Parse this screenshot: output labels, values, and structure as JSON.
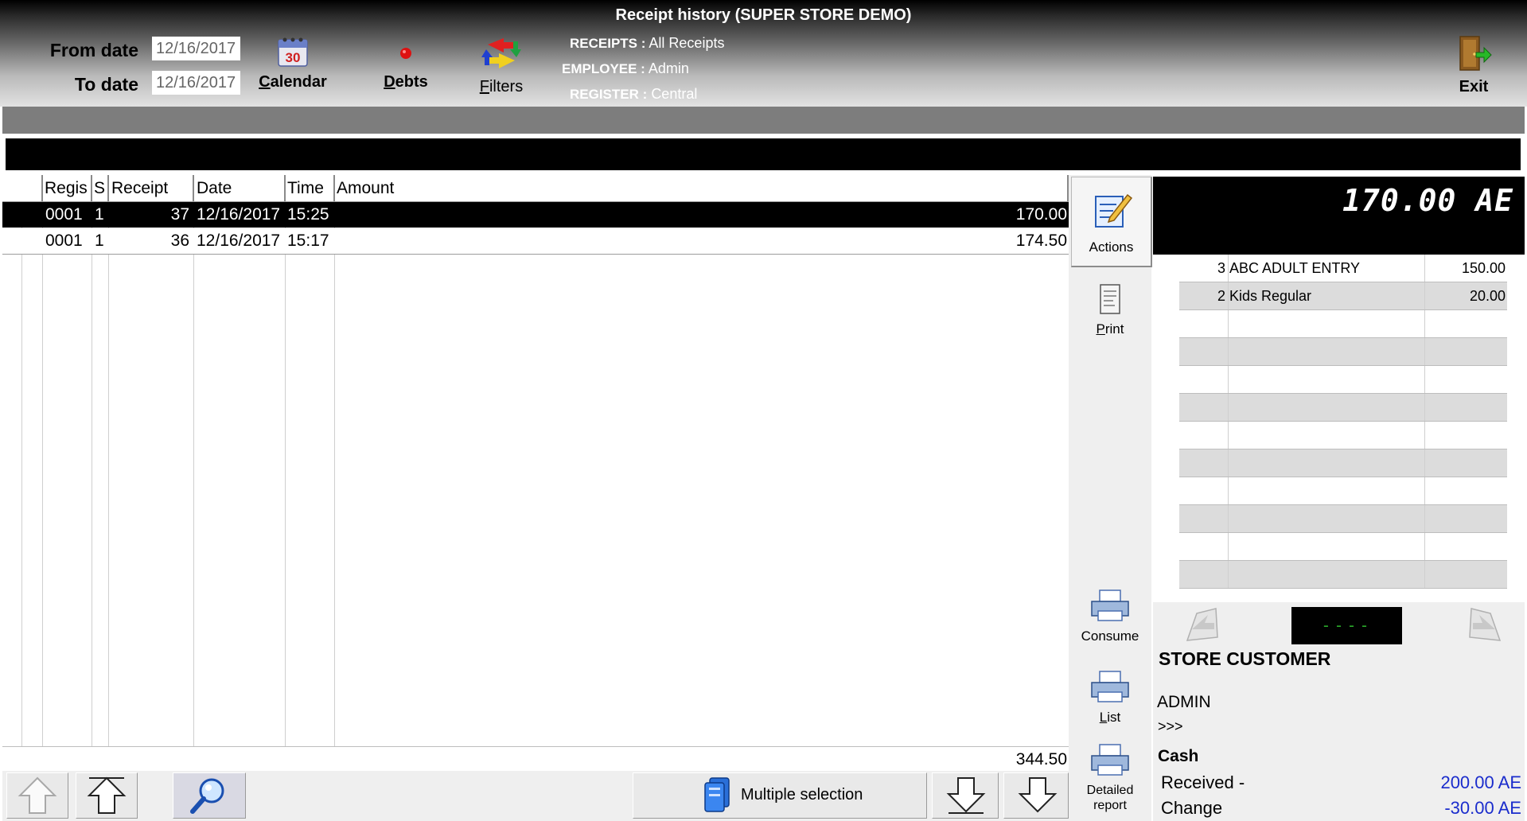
{
  "window": {
    "title": "Receipt history  (SUPER STORE DEMO)"
  },
  "header": {
    "from_label": "From date",
    "to_label": "To  date",
    "from_value": "12/16/2017",
    "to_value": "12/16/2017",
    "calendar_label": "Calendar",
    "debts_label": "Debts",
    "filters_label": "Filters",
    "exit_label": "Exit",
    "receipts_key": "RECEIPTS :",
    "receipts_val": "All Receipts",
    "employee_key": "EMPLOYEE :",
    "employee_val": "Admin",
    "register_key": "REGISTER :",
    "register_val": "Central"
  },
  "table": {
    "columns": [
      "Regis",
      "S",
      "Receipt",
      "Date",
      "Time",
      "Amount"
    ],
    "rows": [
      {
        "register": "0001",
        "s": "1",
        "receipt": "37",
        "date": "12/16/2017",
        "time": "15:25",
        "amount": "170.00",
        "selected": true
      },
      {
        "register": "0001",
        "s": "1",
        "receipt": "36",
        "date": "12/16/2017",
        "time": "15:17",
        "amount": "174.50",
        "selected": false
      }
    ],
    "total": "344.50"
  },
  "bottom": {
    "multi_label": "Multiple selection"
  },
  "actions": {
    "actions_label": "Actions",
    "print_label": "Print",
    "consume_label": "Consume",
    "list_label": "List",
    "detailed_label_1": "Detailed",
    "detailed_label_2": "report"
  },
  "receipt": {
    "total": "170.00 AE",
    "lines": [
      {
        "qty": "3",
        "name": "ABC ADULT ENTRY",
        "amount": "150.00"
      },
      {
        "qty": "2",
        "name": "Kids Regular",
        "amount": "20.00"
      }
    ],
    "mini_display": "----",
    "customer": "STORE CUSTOMER",
    "employee": "ADMIN",
    "more": ">>>",
    "payment_method": "Cash",
    "received_label": "Received -",
    "received_value": "200.00 AE",
    "change_label": "Change",
    "change_value": "-30.00 AE",
    "value_color": "#1a2ccc"
  }
}
